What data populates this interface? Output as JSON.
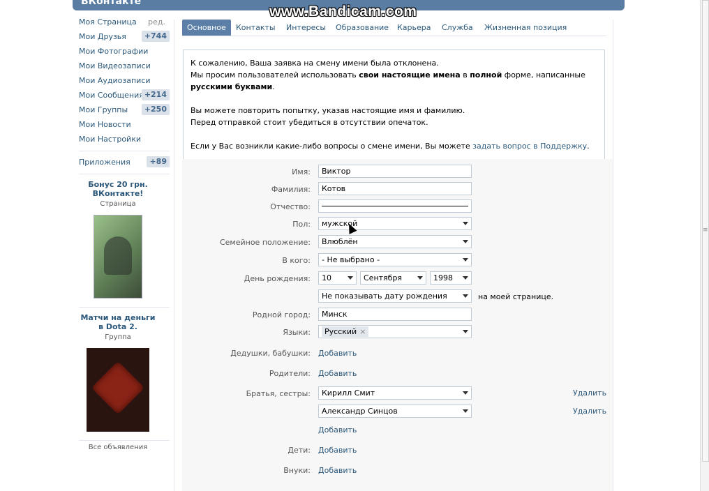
{
  "header": {
    "logo": "ВКонтакте",
    "watermark": "www.Bandicam.com"
  },
  "leftnav": {
    "items": [
      {
        "label": "Моя Страница",
        "extra": "ред."
      },
      {
        "label": "Мои Друзья",
        "count": "+744"
      },
      {
        "label": "Мои Фотографии"
      },
      {
        "label": "Мои Видеозаписи"
      },
      {
        "label": "Мои Аудиозаписи"
      },
      {
        "label": "Мои Сообщения",
        "count": "+214"
      },
      {
        "label": "Мои Группы",
        "count": "+250"
      },
      {
        "label": "Мои Новости"
      },
      {
        "label": "Мои Настройки"
      },
      {
        "label": "Приложения",
        "count": "+89"
      }
    ],
    "ad1": {
      "title": "Бонус 20 грн. ВКонтакте!",
      "subtitle": "Страница"
    },
    "ad2": {
      "title": "Матчи на деньги в Dota 2.",
      "subtitle": "Группа"
    },
    "all_ads": "Все объявления"
  },
  "tabs": [
    "Основное",
    "Контакты",
    "Интересы",
    "Образование",
    "Карьера",
    "Служба",
    "Жизненная позиция"
  ],
  "notice": {
    "line1": "К сожалению, Ваша заявка на смену имени была отклонена.",
    "line2a": "Мы просим пользователей использовать ",
    "line2b": "свои настоящие имена",
    "line2c": " в ",
    "line2d": "полной",
    "line2e": " форме, написанные ",
    "line2f": "русскими буквами",
    "line2g": ".",
    "line3": "Вы можете повторить попытку, указав настоящие имя и фамилию.",
    "line4": "Перед отправкой стоит убедиться в отсутствии опечаток.",
    "line5a": "Если у Вас возникли какие-либо вопросы о смене имени, Вы можете ",
    "line5b": "задать вопрос в Поддержку",
    "line5c": "."
  },
  "form": {
    "name_label": "Имя:",
    "name_value": "Виктор",
    "surname_label": "Фамилия:",
    "surname_value": "Котов",
    "patronymic_label": "Отчество:",
    "gender_label": "Пол:",
    "gender_value": "мужской",
    "status_label": "Семейное положение:",
    "status_value": "Влюблён",
    "with_label": "В кого:",
    "with_value": "- Не выбрано -",
    "birthday_label": "День рождения:",
    "bday_day": "10",
    "bday_month": "Сентября",
    "bday_year": "1998",
    "bday_show_value": "Не показывать дату рождения",
    "bday_show_note": "на моей странице.",
    "hometown_label": "Родной город:",
    "hometown_value": "Минск",
    "languages_label": "Языки:",
    "language_tag": "Русский",
    "tag_remove": "×",
    "grandparents_label": "Дедушки, бабушки:",
    "parents_label": "Родители:",
    "siblings_label": "Братья, сестры:",
    "sibling1": "Кирилл Смит",
    "sibling2": "Александр Синцов",
    "children_label": "Дети:",
    "grandchildren_label": "Внуки:",
    "add": "Добавить",
    "delete": "Удалить"
  }
}
